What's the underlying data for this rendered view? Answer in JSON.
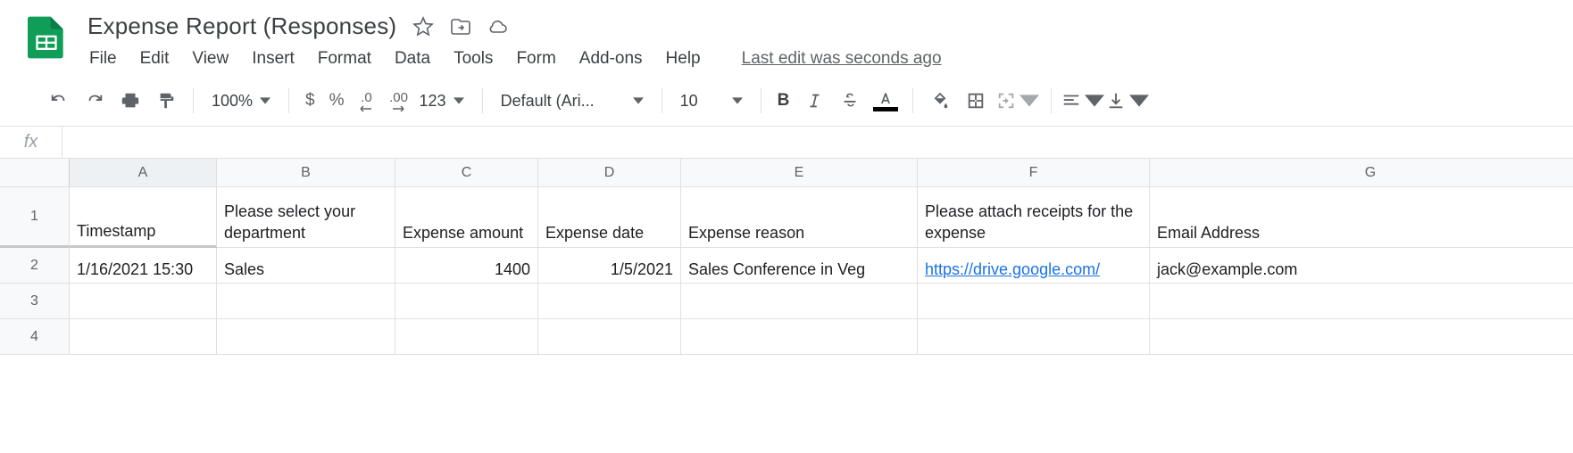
{
  "doc": {
    "title": "Expense Report (Responses)"
  },
  "menu": {
    "file": "File",
    "edit": "Edit",
    "view": "View",
    "insert": "Insert",
    "format": "Format",
    "data": "Data",
    "tools": "Tools",
    "form": "Form",
    "addons": "Add-ons",
    "help": "Help",
    "last_edit": "Last edit was seconds ago"
  },
  "toolbar": {
    "zoom": "100%",
    "dollar": "$",
    "percent": "%",
    "dec_dec": ".0",
    "dec_inc": ".00",
    "more_fmt": "123",
    "font": "Default (Ari...",
    "font_size": "10",
    "bold": "B"
  },
  "formula": {
    "fx": "fx",
    "value": ""
  },
  "columns": [
    "A",
    "B",
    "C",
    "D",
    "E",
    "F",
    "G"
  ],
  "rows": [
    "1",
    "2",
    "3",
    "4"
  ],
  "headers": {
    "A": "Timestamp",
    "B": "Please select your department",
    "C": "Expense amount",
    "D": "Expense date",
    "E": "Expense reason",
    "F": "Please attach receipts for the expense",
    "G": "Email Address"
  },
  "data_row": {
    "A": "1/16/2021 15:30",
    "B": "Sales",
    "C": "1400",
    "D": "1/5/2021",
    "E": "Sales Conference in Veg",
    "F": "https://drive.google.com/",
    "G": "jack@example.com"
  }
}
